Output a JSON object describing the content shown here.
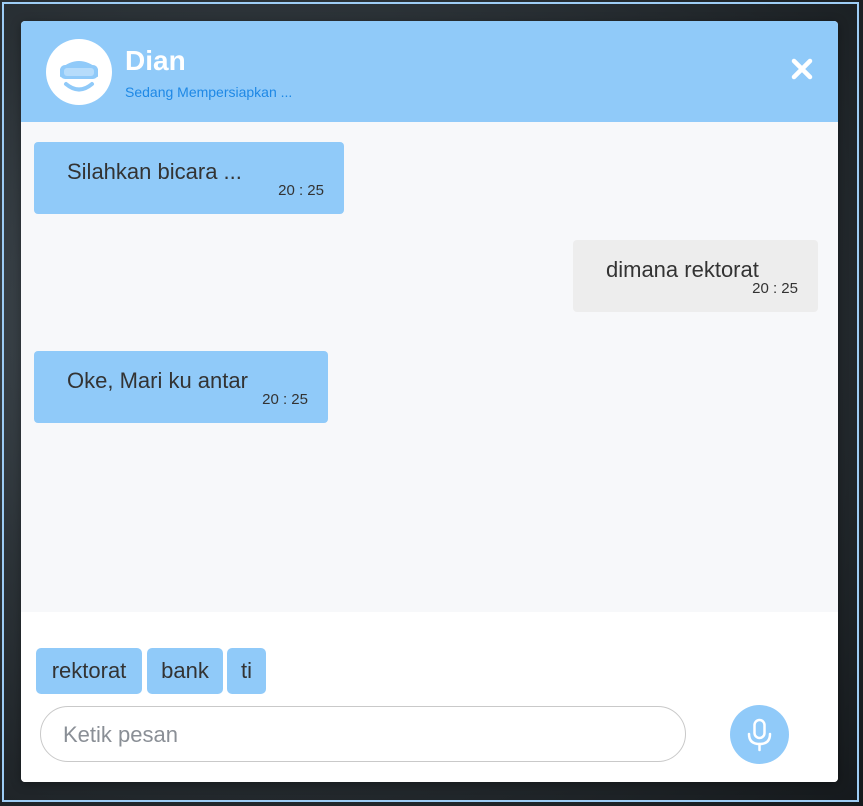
{
  "header": {
    "agent_name": "Dian",
    "status": "Sedang Mempersiapkan ...",
    "avatar_icon": "robot-visor-icon",
    "close_icon": "close-icon"
  },
  "messages": [
    {
      "sender": "bot",
      "text": "Silahkan bicara ...",
      "time": "20 : 25"
    },
    {
      "sender": "user",
      "text": "dimana rektorat",
      "time": "20 : 25"
    },
    {
      "sender": "bot",
      "text": "Oke, Mari ku antar",
      "time": "20 : 25"
    }
  ],
  "quick_replies": [
    "rektorat",
    "bank",
    "ti"
  ],
  "composer": {
    "placeholder": "Ketik pesan",
    "value": "",
    "mic_icon": "microphone-icon"
  },
  "colors": {
    "accent": "#90caf9",
    "status_text": "#1e88e5",
    "user_bubble": "#ededed",
    "chat_background": "#f7f8fa"
  }
}
